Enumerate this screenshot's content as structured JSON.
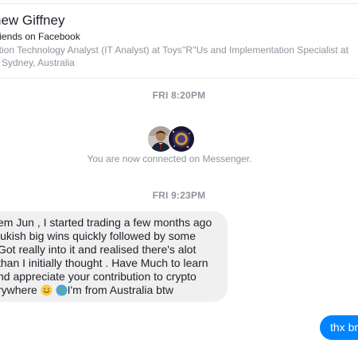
{
  "profile": {
    "name": "hew Giffney",
    "friends_line": "friends on Facebook",
    "work_line": "ation Technology Analyst (IT Analyst) at Toys''R''Us and Implementation Specialist at",
    "location_line": "n Sydney, Australia"
  },
  "conversation": {
    "timestamp_1": "FRI 8:20PM",
    "connected_note": "You are now connected on Messenger.",
    "timestamp_2": "FRI 9:23PM",
    "incoming_message": {
      "line_1": "em Jun , I started trading a few months ago",
      "line_2": "lukish big wins quickly followed by some",
      "line_3": " Got really into it and realised there's alot",
      "line_4": "than I initially thought . Have Much to learn",
      "line_5": "nd appreciate your contribution to crypto",
      "line_6_before": "rywhere ",
      "line_6_after": "I'm from Australia btw"
    },
    "outgoing_message": "thx br"
  },
  "icons": {
    "emoji_1": "smile-emoji-icon",
    "emoji_2": "globe-emoji-icon"
  },
  "colors": {
    "outgoing_bubble": "#0084ff",
    "incoming_bubble": "#f1f0f0",
    "meta_text": "#90949c"
  }
}
